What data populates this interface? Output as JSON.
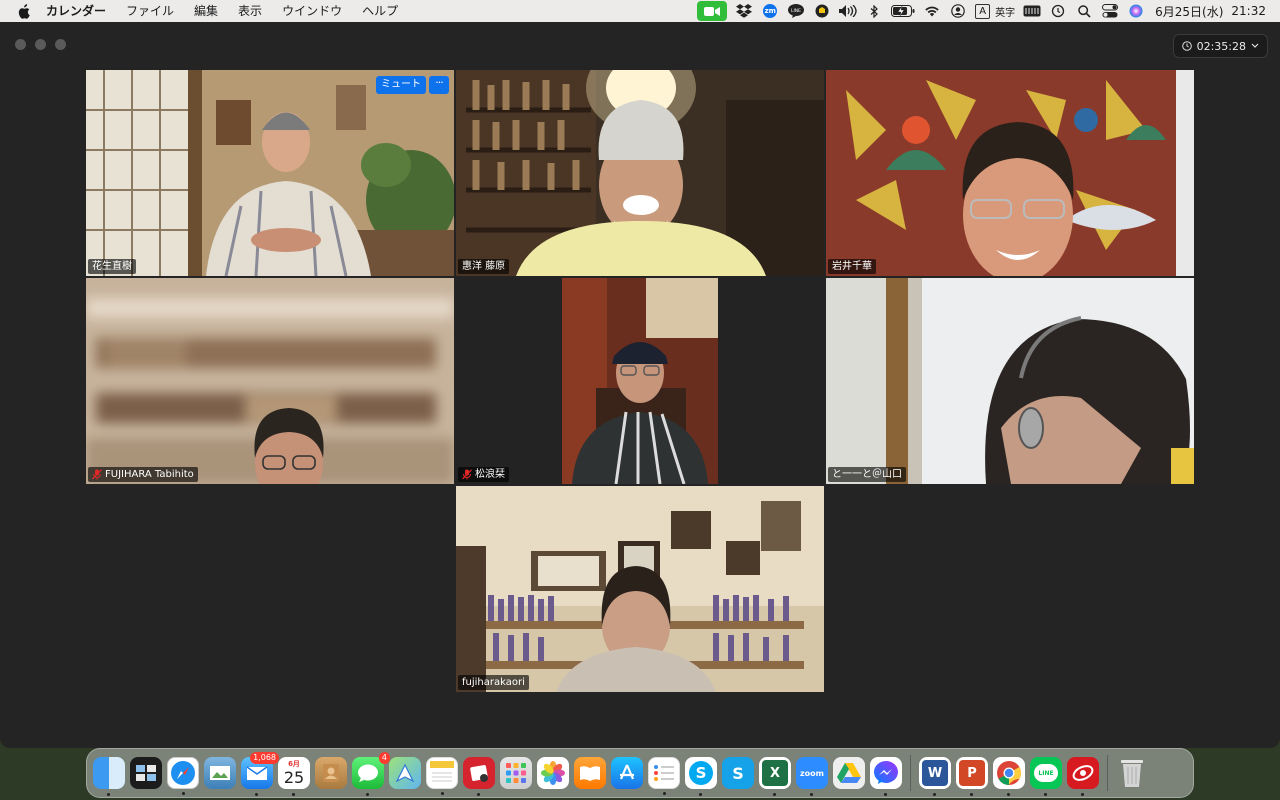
{
  "menubar": {
    "items": [
      "カレンダー",
      "ファイル",
      "編集",
      "表示",
      "ウインドウ",
      "ヘルプ"
    ],
    "status": {
      "input_mode_box": "A",
      "input_mode": "英字",
      "date": "6月25日(水)",
      "time": "21:32"
    }
  },
  "meeting": {
    "elapsed": "02:35:28"
  },
  "tiles": [
    {
      "name": "花生直樹",
      "muted": false,
      "active": false,
      "mute_label": "ミュート",
      "more_label": "···"
    },
    {
      "name": "惠洋 藤原",
      "muted": false,
      "active": false
    },
    {
      "name": "岩井千華",
      "muted": false,
      "active": false
    },
    {
      "name": "FUJIHARA Tabihito",
      "muted": true,
      "active": false
    },
    {
      "name": "松浪栞",
      "muted": true,
      "active": false
    },
    {
      "name": "と一一と＠山口",
      "muted": false,
      "active": true
    },
    {
      "name": "fujiharakaori",
      "muted": false,
      "active": false
    }
  ],
  "dock": {
    "mail_badge": "1,068",
    "messages_badge": "4",
    "calendar_month": "6月",
    "calendar_day": "25",
    "zoom_label": "zoom",
    "line_label": "LINE",
    "excel_label": "X",
    "word_label": "W",
    "ppt_label": "P",
    "skype_label": "S"
  },
  "colors": {
    "accent": "#0e72ed",
    "active_speaker": "#27c24c",
    "zoom_green": "#2fbd3a"
  }
}
